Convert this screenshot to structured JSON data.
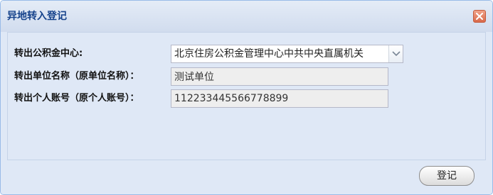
{
  "dialog": {
    "title": "异地转入登记"
  },
  "form": {
    "center": {
      "label": "转出公积金中心:",
      "value": "北京住房公积金管理中心中共中央直属机关"
    },
    "unit": {
      "label": "转出单位名称（原单位名称）：",
      "value": "测试单位"
    },
    "account": {
      "label": "转出个人账号（原个人账号）：",
      "value": "112233445566778899"
    }
  },
  "footer": {
    "submit_label": "登记"
  },
  "icons": {
    "close": "close-icon",
    "dropdown": "chevron-down-icon"
  },
  "colors": {
    "title": "#15428b",
    "panel_bg": "#dfe8f6",
    "close_bg": "#d9694a"
  }
}
